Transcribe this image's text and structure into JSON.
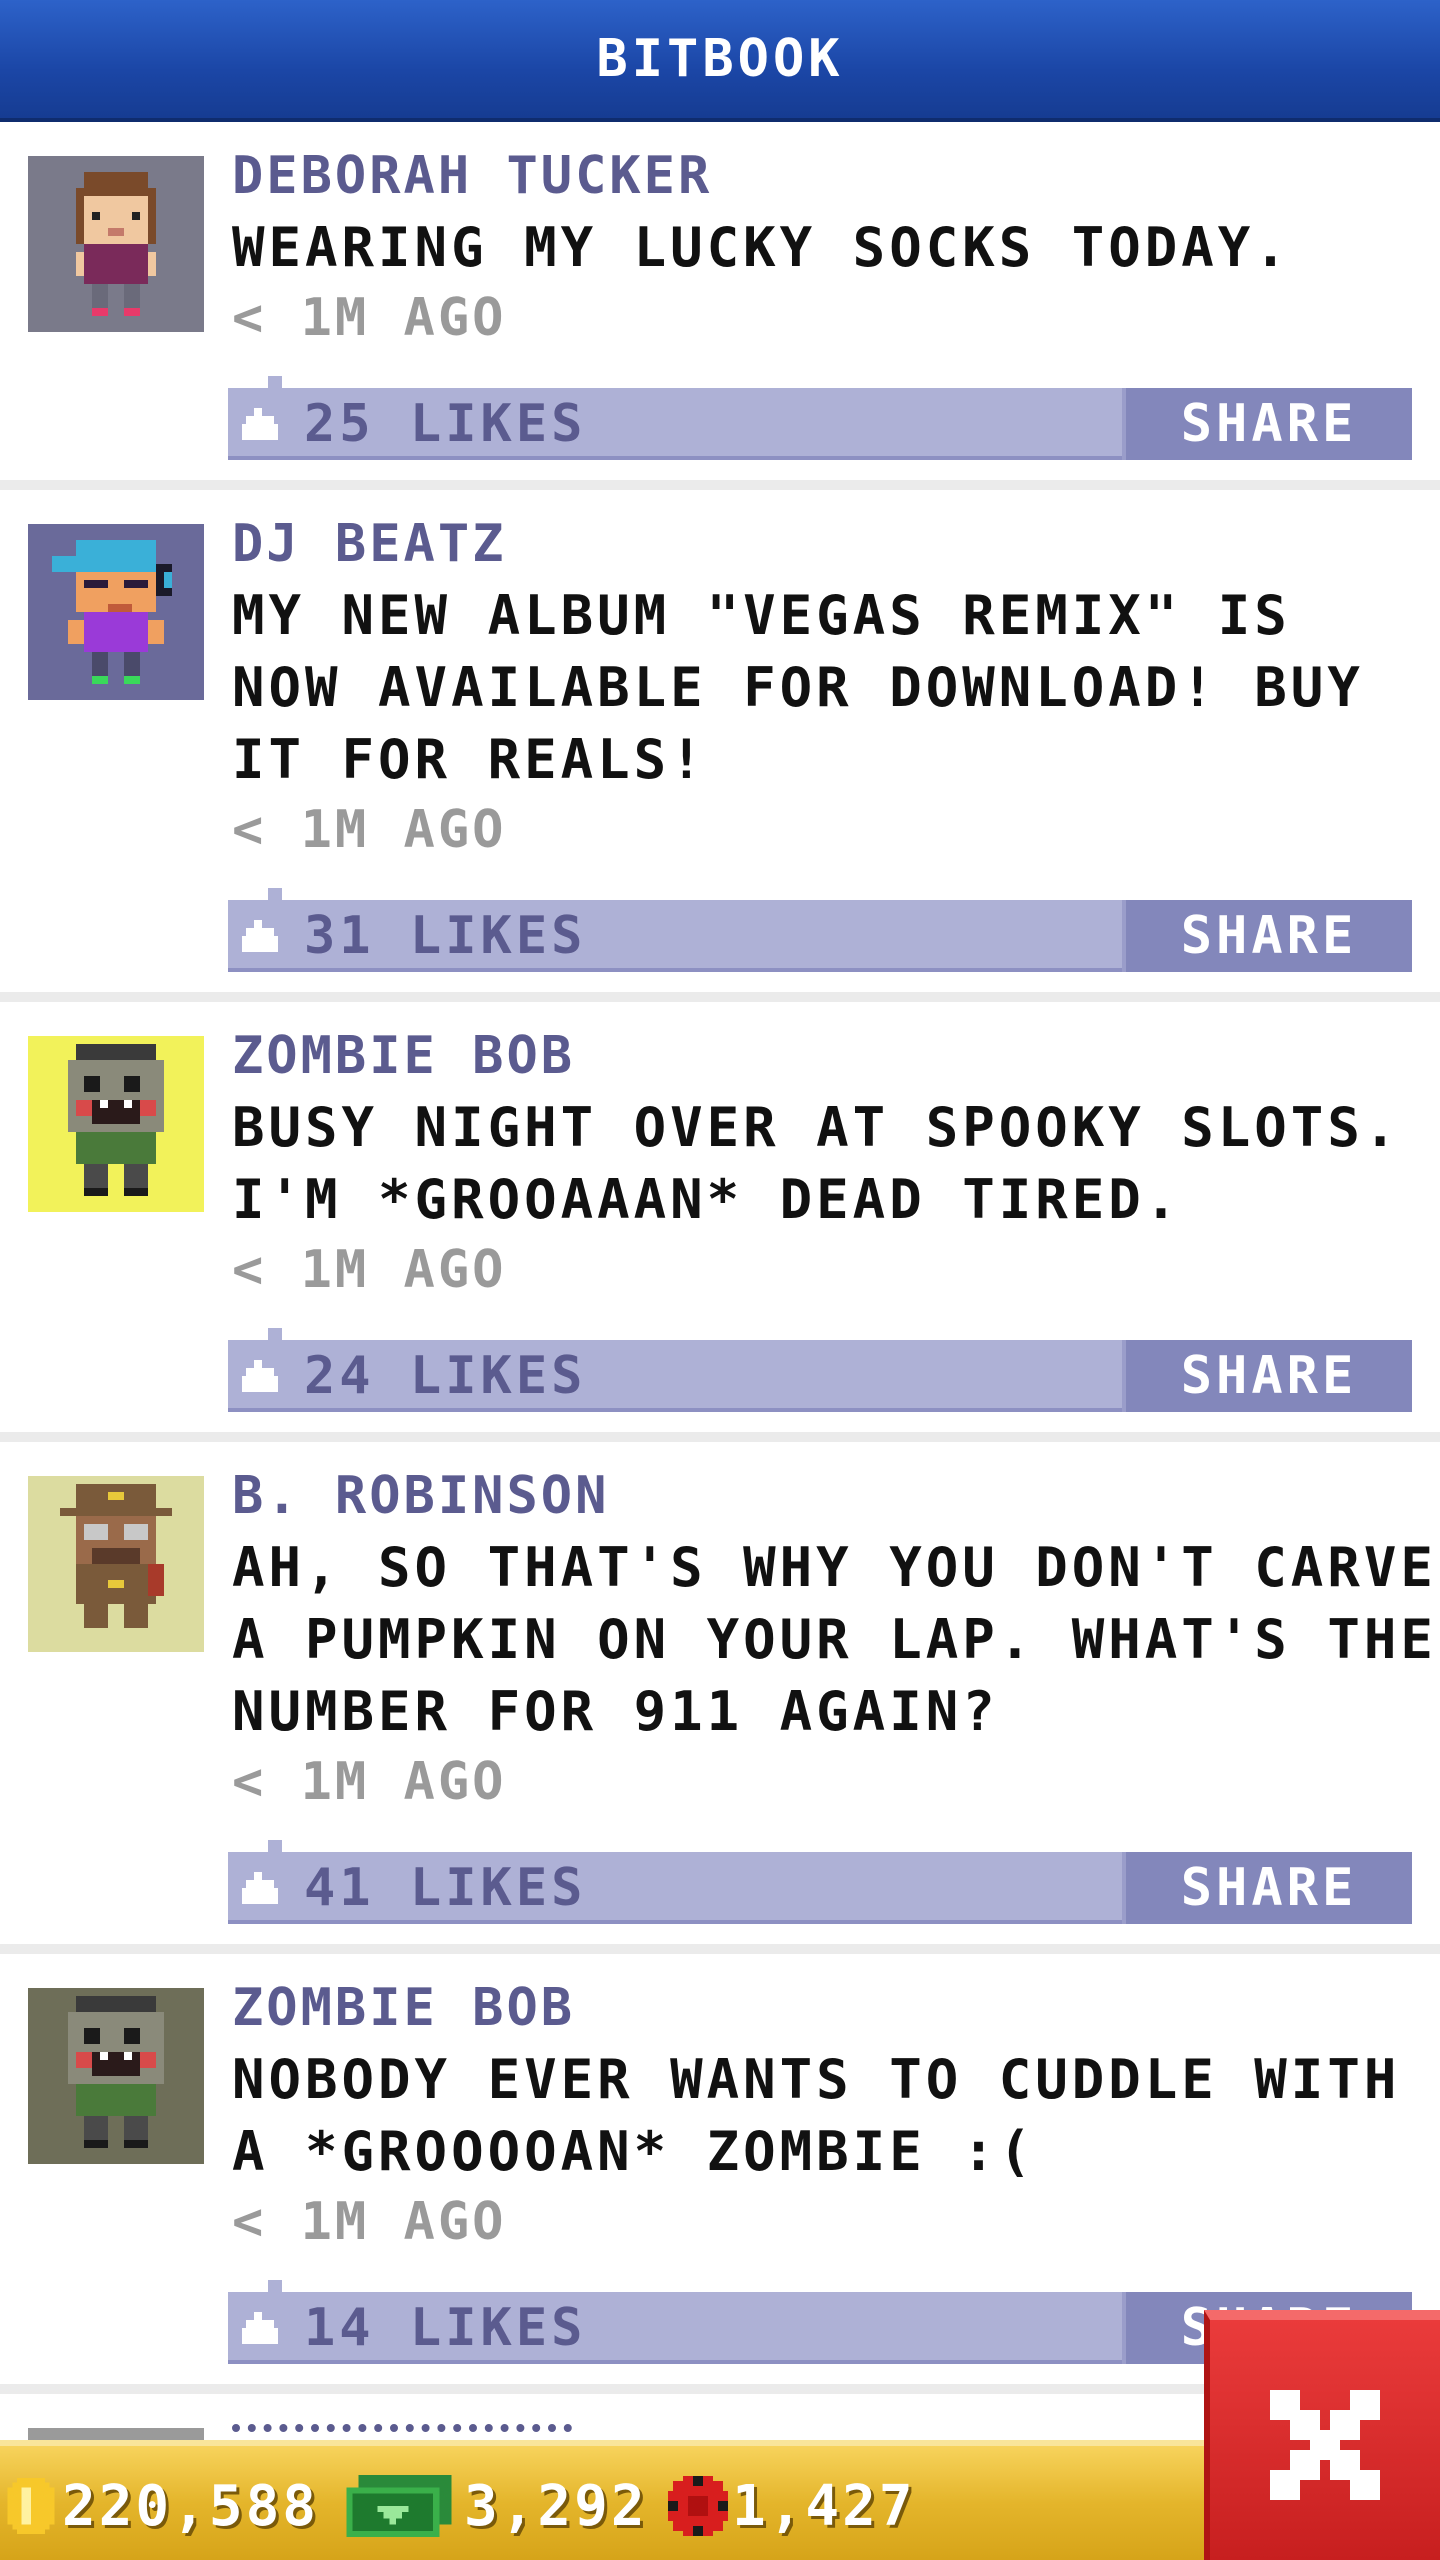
{
  "app": {
    "title": "BITBOOK"
  },
  "posts": [
    {
      "author": "DEBORAH TUCKER",
      "lines": [
        "WEARING MY LUCKY SOCKS TODAY."
      ],
      "time": "< 1M AGO",
      "likes": "25 LIKES",
      "share_label": "SHARE",
      "avatar_bg": "#7a7a8a",
      "avatar_icon": "avatar-woman-icon"
    },
    {
      "author": "DJ BEATZ",
      "lines": [
        "MY NEW ALBUM \"VEGAS REMIX\" IS",
        "NOW AVAILABLE FOR DOWNLOAD! BUY",
        "IT FOR REALS!"
      ],
      "time": "< 1M AGO",
      "likes": "31 LIKES",
      "share_label": "SHARE",
      "avatar_bg": "#6a6a9a",
      "avatar_icon": "avatar-dj-icon"
    },
    {
      "author": "ZOMBIE BOB",
      "lines": [
        "BUSY NIGHT OVER AT SPOOKY SLOTS.",
        "I'M *GROOAAAN* DEAD TIRED."
      ],
      "time": "< 1M AGO",
      "likes": "24 LIKES",
      "share_label": "SHARE",
      "avatar_bg": "#f2f25a",
      "avatar_icon": "avatar-zombie-icon"
    },
    {
      "author": "B. ROBINSON",
      "lines": [
        "AH, SO THAT'S WHY YOU DON'T CARVE",
        "A PUMPKIN ON YOUR LAP. WHAT'S THE",
        "NUMBER FOR 911 AGAIN?"
      ],
      "time": "< 1M AGO",
      "likes": "41 LIKES",
      "share_label": "SHARE",
      "avatar_bg": "#dcdca0",
      "avatar_icon": "avatar-explorer-icon"
    },
    {
      "author": "ZOMBIE BOB",
      "lines": [
        "NOBODY EVER WANTS TO CUDDLE WITH",
        "A *GROOOOAN* ZOMBIE :("
      ],
      "time": "< 1M AGO",
      "likes": "14 LIKES",
      "share_label": "SHARE",
      "avatar_bg": "#6e6e58",
      "avatar_icon": "avatar-zombie-icon"
    }
  ],
  "footer": {
    "coins": "220,588",
    "cash": "3,292",
    "chips": "1,427"
  },
  "colors": {
    "header": "#1b46a6",
    "likebar": "#aeb1d6",
    "share": "#8387bb",
    "author": "#5b5b8f",
    "footer": "#e4b52b",
    "close": "#d92a2a"
  }
}
